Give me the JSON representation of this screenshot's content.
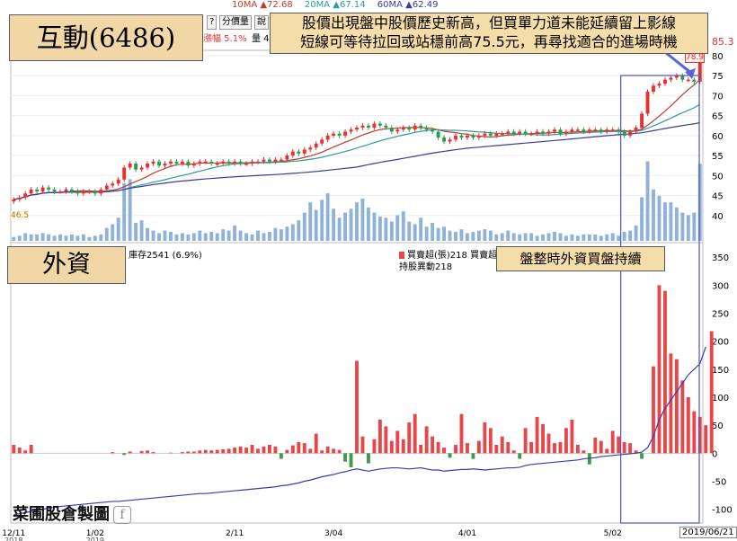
{
  "title": "互動(6486)",
  "annotation_main": [
    "股價出現盤中股價歷史新高，但買單力道未能延續留上影線",
    "短線可等待拉回或站穩前高75.5元，再尋找適合的進場時機"
  ],
  "foreign_label": "外資",
  "foreign_annotation": "盤整時外資買盤持續",
  "watermark": "菜圃股倉製圖",
  "watermark_icon": "f-icon",
  "toolbar": {
    "q": "?",
    "adj": "分價量",
    "extra": "說"
  },
  "change_label": "漲幅 5.1%",
  "volume_label": "量 4",
  "price_right": "85.3",
  "price_tag": "78.9",
  "left_tag": "46.5",
  "foreign_stock": "庫存2541 (6.9%)",
  "foreign_legend": {
    "buy": "買賣超(張)218 買賣超(",
    "hold": "持股異動218"
  },
  "date_badge": "2019/06/21",
  "ma_legend": [
    {
      "name": "10MA ▲72.68",
      "color": "#c0392b"
    },
    {
      "name": "20MA ▲67.14",
      "color": "#2a9d9a"
    },
    {
      "name": "60MA ▲62.49",
      "color": "#3b3b9c"
    }
  ],
  "colors": {
    "up": "#e8302e",
    "down": "#2b9c4a",
    "vol": "#8fb2d9",
    "ma10": "#c0392b",
    "ma20": "#2a9d9a",
    "ma60": "#3b3b9c",
    "buy": "#e8474a",
    "sell": "#3e9b4a",
    "hold": "#3b3bb0"
  },
  "chart_data": [
    {
      "type": "candlestick",
      "x_ticks": [
        "12/11",
        "1/02",
        "2/11",
        "3/04",
        "4/01",
        "5/02",
        "6/03"
      ],
      "x_tick_sub": [
        "2018",
        "2019"
      ],
      "ylim": [
        35,
        80
      ],
      "y_ticks": [
        40,
        45,
        50,
        55,
        60,
        65,
        70,
        75,
        80
      ],
      "close": [
        44.0,
        44.5,
        45.5,
        46.5,
        46.0,
        47.0,
        46.5,
        46.0,
        46.0,
        46.5,
        46.0,
        45.5,
        46.0,
        46.0,
        45.5,
        46.5,
        47.5,
        48.0,
        49.0,
        52.0,
        53.0,
        51.5,
        52.0,
        53.0,
        53.5,
        52.5,
        53.0,
        53.5,
        53.0,
        53.5,
        52.5,
        53.0,
        53.5,
        53.5,
        53.0,
        53.0,
        53.5,
        53.0,
        53.5,
        53.0,
        53.0,
        53.5,
        53.5,
        54.0,
        53.5,
        54.0,
        54.0,
        55.0,
        56.0,
        55.5,
        56.5,
        57.0,
        58.0,
        59.0,
        60.0,
        60.5,
        60.0,
        61.0,
        61.5,
        62.0,
        62.5,
        62.0,
        63.0,
        62.5,
        62.0,
        61.0,
        61.5,
        62.0,
        61.5,
        62.5,
        62.0,
        61.5,
        61.0,
        59.5,
        58.5,
        59.0,
        60.0,
        59.5,
        60.0,
        59.5,
        60.0,
        60.5,
        60.0,
        60.5,
        60.5,
        61.0,
        60.5,
        61.0,
        60.5,
        60.5,
        61.0,
        60.5,
        61.0,
        61.5,
        60.5,
        61.0,
        61.5,
        61.5,
        61.0,
        61.5,
        61.5,
        61.0,
        61.5,
        61.5,
        61.0,
        60.0,
        61.0,
        62.0,
        65.5,
        71.0,
        72.5,
        73.0,
        74.0,
        74.5,
        75.0,
        74.0,
        74.0,
        73.5,
        78.9
      ],
      "volume": [
        0.3,
        0.4,
        0.6,
        0.5,
        0.5,
        0.6,
        0.5,
        0.4,
        0.5,
        0.4,
        0.5,
        0.4,
        0.5,
        0.3,
        0.4,
        0.5,
        1.0,
        1.3,
        1.8,
        4.5,
        4.8,
        1.4,
        1.6,
        1.0,
        0.8,
        0.6,
        0.8,
        0.7,
        0.5,
        0.6,
        0.5,
        0.6,
        0.8,
        0.6,
        0.7,
        0.6,
        0.9,
        0.8,
        1.2,
        0.8,
        0.6,
        0.5,
        0.8,
        0.6,
        0.7,
        1.0,
        0.9,
        1.1,
        1.3,
        1.6,
        2.2,
        3.0,
        2.4,
        3.2,
        3.7,
        2.5,
        1.8,
        2.2,
        2.5,
        3.0,
        3.3,
        2.6,
        2.2,
        1.9,
        1.8,
        1.5,
        2.0,
        2.3,
        1.5,
        1.3,
        1.8,
        1.1,
        1.4,
        1.0,
        1.1,
        0.8,
        0.7,
        0.9,
        0.6,
        0.7,
        0.8,
        0.9,
        0.8,
        0.5,
        0.6,
        0.8,
        0.6,
        0.5,
        0.6,
        0.6,
        0.4,
        0.5,
        0.6,
        0.7,
        0.6,
        0.4,
        0.5,
        0.4,
        0.5,
        0.5,
        0.5,
        0.4,
        0.5,
        0.6,
        0.4,
        0.7,
        0.8,
        1.2,
        3.4,
        6.2,
        4.0,
        3.5,
        3.0,
        3.0,
        2.6,
        2.2,
        2.0,
        2.2,
        6.0
      ],
      "vol_max": 7,
      "ma10": "10MA",
      "ma20": "20MA",
      "ma60": "60MA"
    },
    {
      "type": "bar",
      "ylim": [
        -115,
        360
      ],
      "y_ticks": [
        -100,
        -50,
        0,
        50,
        100,
        150,
        200,
        250,
        300,
        350
      ],
      "values": [
        15,
        10,
        5,
        15,
        0,
        0,
        0,
        0,
        0,
        0,
        0,
        0,
        0,
        0,
        0,
        0,
        0,
        2,
        0,
        -3,
        3,
        0,
        4,
        5,
        2,
        0,
        0,
        1,
        0,
        2,
        3,
        3,
        5,
        6,
        5,
        6,
        7,
        8,
        10,
        12,
        10,
        15,
        8,
        12,
        15,
        12,
        -10,
        6,
        14,
        20,
        18,
        8,
        35,
        5,
        12,
        8,
        6,
        -15,
        -25,
        165,
        30,
        -18,
        25,
        60,
        48,
        22,
        40,
        25,
        55,
        70,
        15,
        48,
        30,
        20,
        10,
        -8,
        15,
        70,
        18,
        -10,
        22,
        55,
        45,
        15,
        30,
        20,
        5,
        -10,
        45,
        20,
        65,
        52,
        35,
        18,
        20,
        45,
        60,
        15,
        5,
        -20,
        28,
        22,
        8,
        40,
        30,
        20,
        18,
        5,
        -10,
        0,
        155,
        300,
        290,
        178,
        168,
        130,
        100,
        75,
        65,
        50,
        218
      ],
      "hold_line": [
        -110,
        -108,
        -106,
        -104,
        -102,
        -100,
        -98,
        -96,
        -95,
        -94,
        -93,
        -92,
        -91,
        -90,
        -89,
        -88,
        -87,
        -86,
        -86,
        -85,
        -84,
        -83,
        -82,
        -81,
        -80,
        -79,
        -78,
        -77,
        -76,
        -75,
        -74,
        -73,
        -72,
        -72,
        -71,
        -70,
        -69,
        -68,
        -67,
        -66,
        -65,
        -64,
        -63,
        -62,
        -61,
        -60,
        -58,
        -57,
        -55,
        -53,
        -50,
        -48,
        -45,
        -42,
        -40,
        -38,
        -35,
        -33,
        -30,
        -28,
        -30,
        -32,
        -30,
        -28,
        -27,
        -26,
        -26,
        -27,
        -28,
        -27,
        -26,
        -28,
        -30,
        -30,
        -32,
        -31,
        -30,
        -29,
        -29,
        -28,
        -29,
        -30,
        -29,
        -28,
        -27,
        -26,
        -26,
        -25,
        -22,
        -20,
        -19,
        -18,
        -17,
        -16,
        -15,
        -14,
        -13,
        -12,
        -10,
        -9,
        -8,
        -6,
        -5,
        -4,
        -3,
        -2,
        -1,
        0,
        2,
        10,
        30,
        60,
        80,
        95,
        110,
        125,
        140,
        150,
        160,
        190
      ]
    }
  ]
}
